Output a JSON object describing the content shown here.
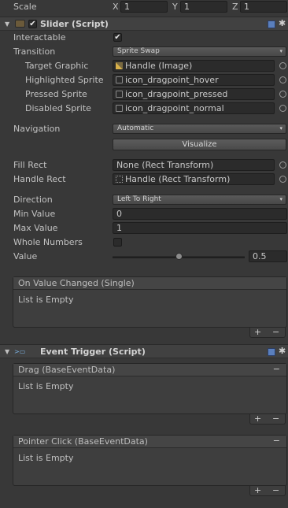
{
  "transform": {
    "scale_label": "Scale",
    "x_label": "X",
    "x_value": "1",
    "y_label": "Y",
    "y_value": "1",
    "z_label": "Z",
    "z_value": "1"
  },
  "slider": {
    "title": "Slider (Script)",
    "enabled": true,
    "interactable_label": "Interactable",
    "interactable_checked": true,
    "transition_label": "Transition",
    "transition_value": "Sprite Swap",
    "target_graphic_label": "Target Graphic",
    "target_graphic_value": "Handle (Image)",
    "highlighted_sprite_label": "Highlighted Sprite",
    "highlighted_sprite_value": "icon_dragpoint_hover",
    "pressed_sprite_label": "Pressed Sprite",
    "pressed_sprite_value": "icon_dragpoint_pressed",
    "disabled_sprite_label": "Disabled Sprite",
    "disabled_sprite_value": "icon_dragpoint_normal",
    "navigation_label": "Navigation",
    "navigation_value": "Automatic",
    "visualize_label": "Visualize",
    "fill_rect_label": "Fill Rect",
    "fill_rect_value": "None (Rect Transform)",
    "handle_rect_label": "Handle Rect",
    "handle_rect_value": "Handle (Rect Transform)",
    "direction_label": "Direction",
    "direction_value": "Left To Right",
    "min_value_label": "Min Value",
    "min_value": "0",
    "max_value_label": "Max Value",
    "max_value": "1",
    "whole_numbers_label": "Whole Numbers",
    "whole_numbers_checked": false,
    "value_label": "Value",
    "value": "0.5",
    "value_fraction": 0.5,
    "on_value_changed_title": "On Value Changed (Single)",
    "list_empty": "List is Empty"
  },
  "event_trigger": {
    "title": "Event Trigger (Script)",
    "entries": [
      {
        "title": "Drag (BaseEventData)",
        "empty": "List is Empty"
      },
      {
        "title": "Pointer Click (BaseEventData)",
        "empty": "List is Empty"
      }
    ]
  },
  "glyphs": {
    "checkmark": "✔",
    "dropdown_arrow": "▾",
    "fold_open": "▼",
    "plus": "+",
    "minus": "−",
    "gear": "✱"
  },
  "colors": {
    "background": "#383838",
    "field": "#2b2b2b",
    "header": "#414141",
    "help_icon": "#5a7fbd"
  }
}
